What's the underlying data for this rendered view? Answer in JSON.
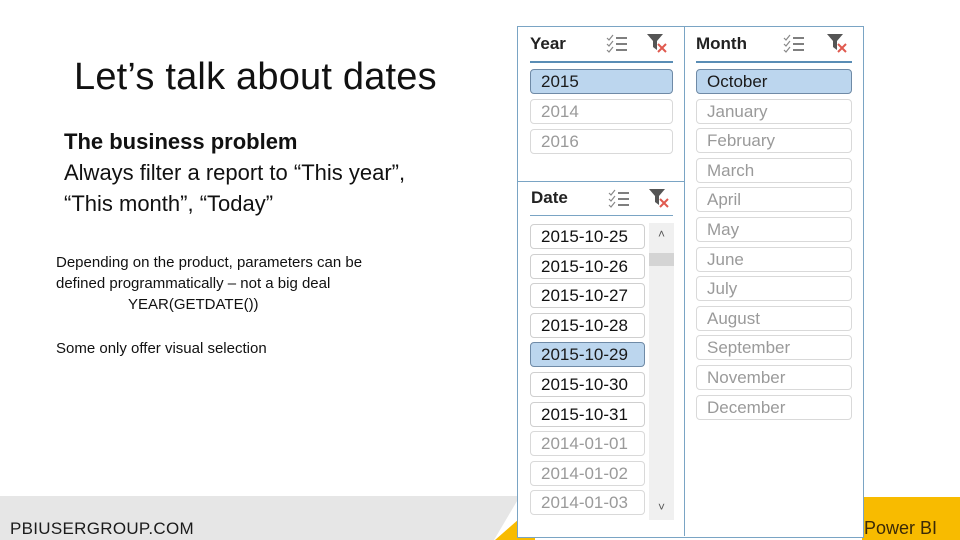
{
  "slide": {
    "title": "Let’s talk about dates",
    "subhead_bold": "The business problem",
    "subhead_line1": "Always filter a report to “This year”,",
    "subhead_line2": "“This month”, “Today”",
    "body_line1": "Depending on the product, parameters can be",
    "body_line2": "defined programmatically – not a big deal",
    "body_code": "YEAR(GETDATE())",
    "body_line3": "Some only offer visual selection"
  },
  "footer": {
    "site": "PBIUSERGROUP.COM",
    "brand": "Power BI",
    "accent_color": "#f8bb00"
  },
  "slicers": {
    "year": {
      "title": "Year",
      "icons": [
        "multi-select-icon",
        "clear-filter-icon"
      ],
      "items": [
        {
          "label": "2015",
          "state": "selected"
        },
        {
          "label": "2014",
          "state": "unavailable"
        },
        {
          "label": "2016",
          "state": "unavailable"
        }
      ]
    },
    "month": {
      "title": "Month",
      "icons": [
        "multi-select-icon",
        "clear-filter-icon"
      ],
      "items": [
        {
          "label": "October",
          "state": "selected"
        },
        {
          "label": "January",
          "state": "unavailable"
        },
        {
          "label": "February",
          "state": "unavailable"
        },
        {
          "label": "March",
          "state": "unavailable"
        },
        {
          "label": "April",
          "state": "unavailable"
        },
        {
          "label": "May",
          "state": "unavailable"
        },
        {
          "label": "June",
          "state": "unavailable"
        },
        {
          "label": "July",
          "state": "unavailable"
        },
        {
          "label": "August",
          "state": "unavailable"
        },
        {
          "label": "September",
          "state": "unavailable"
        },
        {
          "label": "November",
          "state": "unavailable"
        },
        {
          "label": "December",
          "state": "unavailable"
        }
      ]
    },
    "date": {
      "title": "Date",
      "icons": [
        "multi-select-icon",
        "clear-filter-icon"
      ],
      "items": [
        {
          "label": "2015-10-25",
          "state": "available"
        },
        {
          "label": "2015-10-26",
          "state": "available"
        },
        {
          "label": "2015-10-27",
          "state": "available"
        },
        {
          "label": "2015-10-28",
          "state": "available"
        },
        {
          "label": "2015-10-29",
          "state": "selected"
        },
        {
          "label": "2015-10-30",
          "state": "available"
        },
        {
          "label": "2015-10-31",
          "state": "available"
        },
        {
          "label": "2014-01-01",
          "state": "unavailable"
        },
        {
          "label": "2014-01-02",
          "state": "unavailable"
        },
        {
          "label": "2014-01-03",
          "state": "unavailable"
        }
      ],
      "scroll_up": "˄",
      "scroll_down": "˅"
    },
    "colors": {
      "selected_bg": "#bcd6ee",
      "border": "#7aa4c4",
      "clear_x": "#e05a4f"
    }
  }
}
